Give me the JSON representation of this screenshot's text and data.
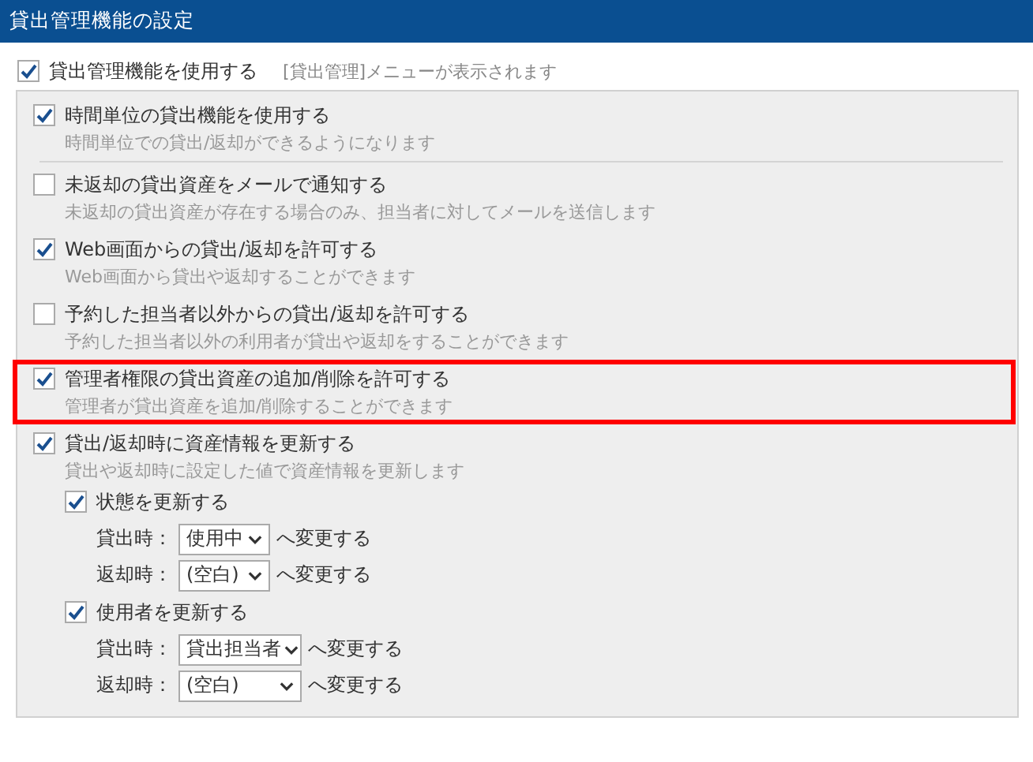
{
  "header": {
    "title": "貸出管理機能の設定"
  },
  "main_option": {
    "label": "貸出管理機能を使用する",
    "note": "[貸出管理]メニューが表示されます",
    "checked": true
  },
  "options": [
    {
      "label": "時間単位の貸出機能を使用する",
      "description": "時間単位での貸出/返却ができるようになります",
      "checked": true,
      "highlighted": false
    },
    {
      "label": "未返却の貸出資産をメールで通知する",
      "description": "未返却の貸出資産が存在する場合のみ、担当者に対してメールを送信します",
      "checked": false,
      "highlighted": false
    },
    {
      "label": "Web画面からの貸出/返却を許可する",
      "description": "Web画面から貸出や返却することができます",
      "checked": true,
      "highlighted": false
    },
    {
      "label": "予約した担当者以外からの貸出/返却を許可する",
      "description": "予約した担当者以外の利用者が貸出や返却をすることができます",
      "checked": false,
      "highlighted": false
    },
    {
      "label": "管理者権限の貸出資産の追加/削除を許可する",
      "description": "管理者が貸出資産を追加/削除することができます",
      "checked": true,
      "highlighted": true
    },
    {
      "label": "貸出/返却時に資産情報を更新する",
      "description": "貸出や返却時に設定した値で資産情報を更新します",
      "checked": true,
      "highlighted": false,
      "sub_options": [
        {
          "label": "状態を更新する",
          "checked": true,
          "rows": [
            {
              "label": "貸出時：",
              "value": "使用中",
              "suffix": "へ変更する"
            },
            {
              "label": "返却時：",
              "value": "(空白)",
              "suffix": "へ変更する"
            }
          ]
        },
        {
          "label": "使用者を更新する",
          "checked": true,
          "rows": [
            {
              "label": "貸出時：",
              "value": "貸出担当者",
              "suffix": "へ変更する"
            },
            {
              "label": "返却時：",
              "value": "(空白)",
              "suffix": "へ変更する"
            }
          ]
        }
      ]
    }
  ]
}
